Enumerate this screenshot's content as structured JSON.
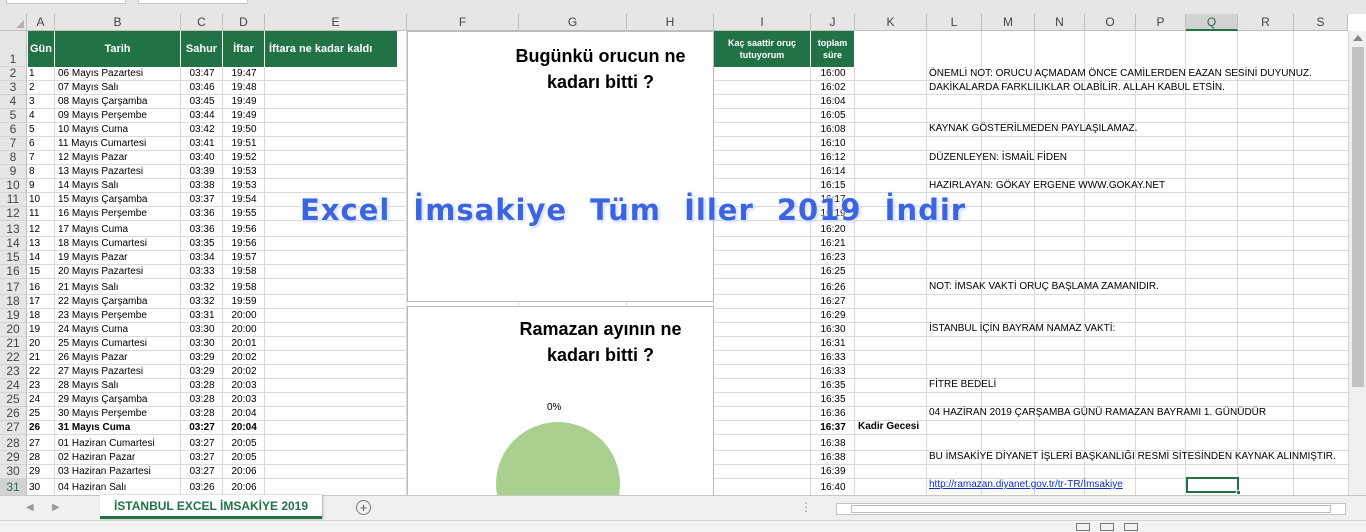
{
  "sheet": {
    "columns": [
      "A",
      "B",
      "C",
      "D",
      "E",
      "F",
      "G",
      "H",
      "I",
      "J",
      "K",
      "L",
      "M",
      "N",
      "O",
      "P",
      "Q",
      "R",
      "S"
    ],
    "selected_column": "Q",
    "rows": [
      "1",
      "2",
      "3",
      "4",
      "5",
      "6",
      "7",
      "8",
      "9",
      "10",
      "11",
      "12",
      "13",
      "14",
      "15",
      "16",
      "17",
      "18",
      "19",
      "20",
      "21",
      "22",
      "23",
      "24",
      "25",
      "26",
      "27",
      "28",
      "29",
      "30",
      "31"
    ],
    "selected_row": "31"
  },
  "headers": {
    "gun": "Gün",
    "tarih": "Tarih",
    "sahur": "Sahur",
    "iftar": "İftar",
    "iftara": "İftara ne kadar kaldı",
    "kac_saat": "Kaç saattir oruç tutuyorum",
    "toplam": "toplam süre"
  },
  "table": [
    {
      "gun": "1",
      "tarih": "06 Mayıs Pazartesi",
      "sahur": "03:47",
      "iftar": "19:47",
      "sure": "16:00"
    },
    {
      "gun": "2",
      "tarih": "07 Mayıs Salı",
      "sahur": "03:46",
      "iftar": "19:48",
      "sure": "16:02"
    },
    {
      "gun": "3",
      "tarih": "08 Mayıs Çarşamba",
      "sahur": "03:45",
      "iftar": "19:49",
      "sure": "16:04"
    },
    {
      "gun": "4",
      "tarih": "09 Mayıs Perşembe",
      "sahur": "03:44",
      "iftar": "19:49",
      "sure": "16:05"
    },
    {
      "gun": "5",
      "tarih": "10 Mayıs Cuma",
      "sahur": "03:42",
      "iftar": "19:50",
      "sure": "16:08"
    },
    {
      "gun": "6",
      "tarih": "11 Mayıs Cumartesi",
      "sahur": "03:41",
      "iftar": "19:51",
      "sure": "16:10"
    },
    {
      "gun": "7",
      "tarih": "12 Mayıs Pazar",
      "sahur": "03:40",
      "iftar": "19:52",
      "sure": "16:12"
    },
    {
      "gun": "8",
      "tarih": "13 Mayıs Pazartesi",
      "sahur": "03:39",
      "iftar": "19:53",
      "sure": "16:14"
    },
    {
      "gun": "9",
      "tarih": "14 Mayıs Salı",
      "sahur": "03:38",
      "iftar": "19:53",
      "sure": "16:15"
    },
    {
      "gun": "10",
      "tarih": "15 Mayıs Çarşamba",
      "sahur": "03:37",
      "iftar": "19:54",
      "sure": "16:17"
    },
    {
      "gun": "11",
      "tarih": "16 Mayıs Perşembe",
      "sahur": "03:36",
      "iftar": "19:55",
      "sure": "16:19"
    },
    {
      "gun": "12",
      "tarih": "17 Mayıs Cuma",
      "sahur": "03:36",
      "iftar": "19:56",
      "sure": "16:20"
    },
    {
      "gun": "13",
      "tarih": "18 Mayıs Cumartesi",
      "sahur": "03:35",
      "iftar": "19:56",
      "sure": "16:21"
    },
    {
      "gun": "14",
      "tarih": "19 Mayıs Pazar",
      "sahur": "03:34",
      "iftar": "19:57",
      "sure": "16:23"
    },
    {
      "gun": "15",
      "tarih": "20 Mayıs Pazartesi",
      "sahur": "03:33",
      "iftar": "19:58",
      "sure": "16:25"
    },
    {
      "gun": "16",
      "tarih": "21 Mayıs Salı",
      "sahur": "03:32",
      "iftar": "19:58",
      "sure": "16:26"
    },
    {
      "gun": "17",
      "tarih": "22 Mayıs Çarşamba",
      "sahur": "03:32",
      "iftar": "19:59",
      "sure": "16:27"
    },
    {
      "gun": "18",
      "tarih": "23 Mayıs Perşembe",
      "sahur": "03:31",
      "iftar": "20:00",
      "sure": "16:29"
    },
    {
      "gun": "19",
      "tarih": "24 Mayıs Cuma",
      "sahur": "03:30",
      "iftar": "20:00",
      "sure": "16:30"
    },
    {
      "gun": "20",
      "tarih": "25 Mayıs Cumartesi",
      "sahur": "03:30",
      "iftar": "20:01",
      "sure": "16:31"
    },
    {
      "gun": "21",
      "tarih": "26 Mayıs Pazar",
      "sahur": "03:29",
      "iftar": "20:02",
      "sure": "16:33"
    },
    {
      "gun": "22",
      "tarih": "27 Mayıs Pazartesi",
      "sahur": "03:29",
      "iftar": "20:02",
      "sure": "16:33"
    },
    {
      "gun": "23",
      "tarih": "28 Mayıs Salı",
      "sahur": "03:28",
      "iftar": "20:03",
      "sure": "16:35"
    },
    {
      "gun": "24",
      "tarih": "29 Mayıs Çarşamba",
      "sahur": "03:28",
      "iftar": "20:03",
      "sure": "16:35"
    },
    {
      "gun": "25",
      "tarih": "30 Mayıs Perşembe",
      "sahur": "03:28",
      "iftar": "20:04",
      "sure": "16:36"
    },
    {
      "gun": "26",
      "tarih": "31 Mayıs Cuma",
      "sahur": "03:27",
      "iftar": "20:04",
      "sure": "16:37",
      "bold": true
    },
    {
      "gun": "27",
      "tarih": "01 Haziran Cumartesi",
      "sahur": "03:27",
      "iftar": "20:05",
      "sure": "16:38"
    },
    {
      "gun": "28",
      "tarih": "02 Haziran Pazar",
      "sahur": "03:27",
      "iftar": "20:05",
      "sure": "16:38"
    },
    {
      "gun": "29",
      "tarih": "03 Haziran Pazartesi",
      "sahur": "03:27",
      "iftar": "20:06",
      "sure": "16:39"
    },
    {
      "gun": "30",
      "tarih": "04 Haziran Salı",
      "sahur": "03:26",
      "iftar": "20:06",
      "sure": "16:40"
    }
  ],
  "kadir_gecesi": "Kadir Gecesi",
  "notes": {
    "r2": "ÖNEMLİ NOT: ORUCU AÇMADAM ÖNCE CAMİLERDEN EAZAN SESİNİ DUYUNUZ.",
    "r3": "DAKİKALARDA FARKLILIKLAR OLABİLİR. ALLAH KABUL ETSİN.",
    "r6": "KAYNAK  GÖSTERİLMEDEN  PAYLAŞILAMAZ.",
    "r8": "DÜZENLEYEN:  İSMAİL FİDEN",
    "r10": "HAZIRLAYAN: GÖKAY ERGENE WWW.GOKAY.NET",
    "r17": "NOT: İMSAK VAKTİ ORUÇ BAŞLAMA ZAMANIDIR.",
    "r20": "İSTANBUL İÇİN BAYRAM NAMAZ VAKTİ:",
    "r24": "FİTRE BEDELİ",
    "r26": "04 HAZİRAN 2019 ÇARŞAMBA GÜNÜ RAMAZAN BAYRAMI 1. GÜNÜDÜR",
    "r29": "BU İMSAKİYE DİYANET İŞLERİ BAŞKANLIĞI RESMİ SİTESİNDEN KAYNAK ALINMIŞTIR.",
    "r31_link": "http://ramazan.diyanet.gov.tr/tr-TR/İmsakiye"
  },
  "panel1": {
    "line1": "Bugünkü orucun ne",
    "line2": "kadarı bitti ?"
  },
  "panel2": {
    "line1": "Ramazan ayının ne",
    "line2": "kadarı bitti ?",
    "percent": "0%"
  },
  "watermark": "Excel İmsakiye Tüm İller 2019 İndir",
  "sheet_tab": "İSTANBUL EXCEL İMSAKİYE 2019",
  "add_sheet": "+",
  "colors": {
    "accent": "#217346",
    "pie": "#a9d08e",
    "watermark": "#3b64e0",
    "link": "#0b2fbf"
  }
}
